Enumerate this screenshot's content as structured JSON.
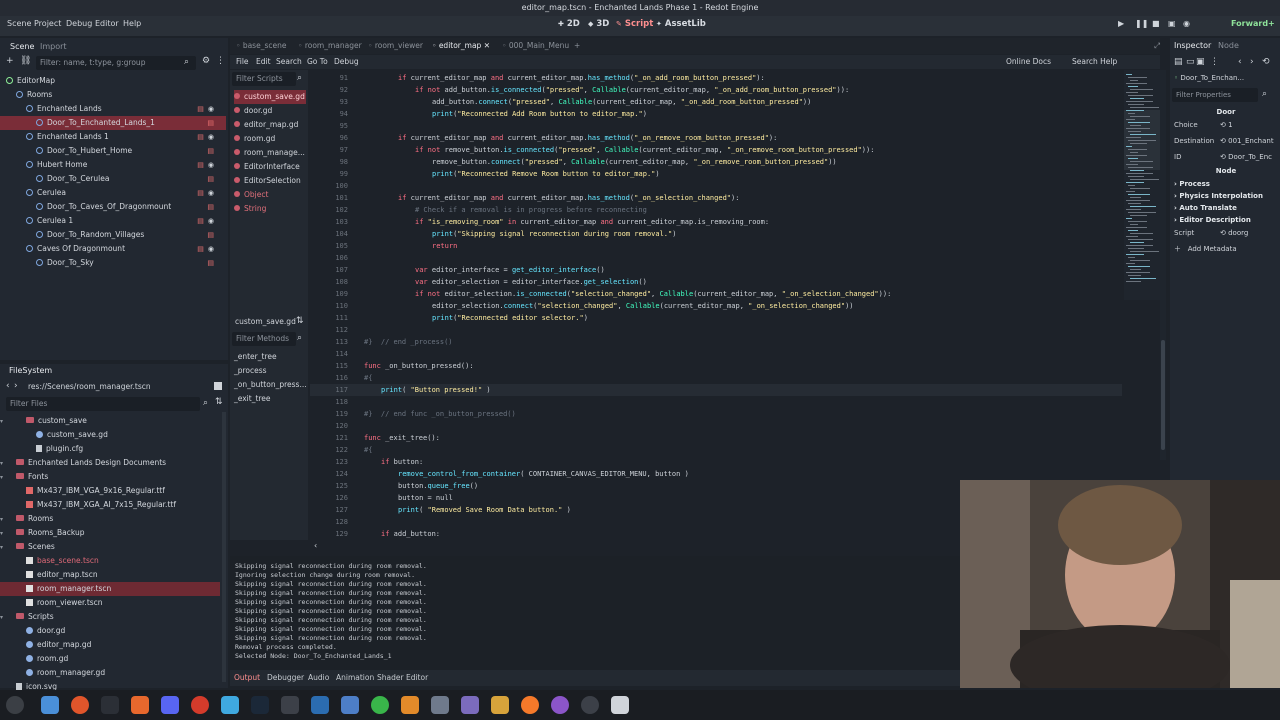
{
  "window": {
    "title": "editor_map.tscn - Enchanted Lands Phase 1 - Redot Engine"
  },
  "menubar": {
    "items": [
      "Scene",
      "Project",
      "Debug",
      "Editor",
      "Help"
    ],
    "workspaces": [
      "2D",
      "3D",
      "Script",
      "AssetLib"
    ],
    "renderer": "Forward+"
  },
  "scene_dock": {
    "tabs": [
      "Scene",
      "Import"
    ],
    "filter_placeholder": "Filter: name, t:type, g:group",
    "nodes": [
      {
        "label": "EditorMap",
        "depth": 0
      },
      {
        "label": "Rooms",
        "depth": 1
      },
      {
        "label": "Enchanted Lands",
        "depth": 2
      },
      {
        "label": "Door_To_Enchanted_Lands_1",
        "depth": 3,
        "selected": true
      },
      {
        "label": "Enchanted Lands 1",
        "depth": 2
      },
      {
        "label": "Door_To_Hubert_Home",
        "depth": 3
      },
      {
        "label": "Hubert Home",
        "depth": 2
      },
      {
        "label": "Door_To_Cerulea",
        "depth": 3
      },
      {
        "label": "Cerulea",
        "depth": 2
      },
      {
        "label": "Door_To_Caves_Of_Dragonmount",
        "depth": 3
      },
      {
        "label": "Cerulea 1",
        "depth": 2
      },
      {
        "label": "Door_To_Random_Villages",
        "depth": 3
      },
      {
        "label": "Caves Of Dragonmount",
        "depth": 2
      },
      {
        "label": "Door_To_Sky",
        "depth": 3
      }
    ]
  },
  "filesystem": {
    "title": "FileSystem",
    "path": "res://Scenes/room_manager.tscn",
    "filter_placeholder": "Filter Files",
    "items": [
      {
        "label": "custom_save",
        "depth": 2,
        "type": "folder"
      },
      {
        "label": "custom_save.gd",
        "depth": 3,
        "type": "gd"
      },
      {
        "label": "plugin.cfg",
        "depth": 3,
        "type": "file"
      },
      {
        "label": "Enchanted Lands Design Documents",
        "depth": 1,
        "type": "folder"
      },
      {
        "label": "Fonts",
        "depth": 1,
        "type": "folder"
      },
      {
        "label": "Mx437_IBM_VGA_9x16_Regular.ttf",
        "depth": 2,
        "type": "font"
      },
      {
        "label": "Mx437_IBM_XGA_AI_7x15_Regular.ttf",
        "depth": 2,
        "type": "font"
      },
      {
        "label": "Rooms",
        "depth": 1,
        "type": "folder"
      },
      {
        "label": "Rooms_Backup",
        "depth": 1,
        "type": "folder"
      },
      {
        "label": "Scenes",
        "depth": 1,
        "type": "folder"
      },
      {
        "label": "base_scene.tscn",
        "depth": 2,
        "type": "tscn",
        "red": true
      },
      {
        "label": "editor_map.tscn",
        "depth": 2,
        "type": "tscn"
      },
      {
        "label": "room_manager.tscn",
        "depth": 2,
        "type": "tscn",
        "selected": true
      },
      {
        "label": "room_viewer.tscn",
        "depth": 2,
        "type": "tscn"
      },
      {
        "label": "Scripts",
        "depth": 1,
        "type": "folder"
      },
      {
        "label": "door.gd",
        "depth": 2,
        "type": "gd"
      },
      {
        "label": "editor_map.gd",
        "depth": 2,
        "type": "gd"
      },
      {
        "label": "room.gd",
        "depth": 2,
        "type": "gd"
      },
      {
        "label": "room_manager.gd",
        "depth": 2,
        "type": "gd"
      },
      {
        "label": "icon.svg",
        "depth": 1,
        "type": "file"
      }
    ]
  },
  "editor_tabs": [
    "base_scene",
    "room_manager",
    "room_viewer",
    "editor_map",
    "000_Main_Menu"
  ],
  "script_menu": [
    "File",
    "Edit",
    "Search",
    "Go To",
    "Debug"
  ],
  "script_menu_right": [
    "Online Docs",
    "Search Help"
  ],
  "script_list": {
    "filter_placeholder": "Filter Scripts",
    "items": [
      "custom_save.gd",
      "door.gd",
      "editor_map.gd",
      "room.gd",
      "room_manage...",
      "EditorInterface",
      "EditorSelection",
      "Object",
      "String"
    ],
    "current": "custom_save.gd",
    "methods_placeholder": "Filter Methods",
    "methods": [
      "_enter_tree",
      "_process",
      "_on_button_press...",
      "_exit_tree"
    ]
  },
  "code_lines": [
    {
      "n": "91",
      "i": 2,
      "t": "if current_editor_map and current_editor_map.has_method(\"_on_add_room_button_pressed\"):"
    },
    {
      "n": "92",
      "i": 3,
      "t": "if not add_button.is_connected(\"pressed\", Callable(current_editor_map, \"_on_add_room_button_pressed\")):"
    },
    {
      "n": "93",
      "i": 4,
      "t": "add_button.connect(\"pressed\", Callable(current_editor_map, \"_on_add_room_button_pressed\"))"
    },
    {
      "n": "94",
      "i": 4,
      "t": "print(\"Reconnected Add Room button to editor_map.\")"
    },
    {
      "n": "95",
      "i": 0,
      "t": ""
    },
    {
      "n": "96",
      "i": 2,
      "t": "if current_editor_map and current_editor_map.has_method(\"_on_remove_room_button_pressed\"):"
    },
    {
      "n": "97",
      "i": 3,
      "t": "if not remove_button.is_connected(\"pressed\", Callable(current_editor_map, \"_on_remove_room_button_pressed\")):"
    },
    {
      "n": "98",
      "i": 4,
      "t": "remove_button.connect(\"pressed\", Callable(current_editor_map, \"_on_remove_room_button_pressed\"))"
    },
    {
      "n": "99",
      "i": 4,
      "t": "print(\"Reconnected Remove Room button to editor_map.\")"
    },
    {
      "n": "100",
      "i": 0,
      "t": ""
    },
    {
      "n": "101",
      "i": 2,
      "t": "if current_editor_map and current_editor_map.has_method(\"_on_selection_changed\"):"
    },
    {
      "n": "102",
      "i": 3,
      "t": "# Check if a removal is in progress before reconnecting"
    },
    {
      "n": "103",
      "i": 3,
      "t": "if \"is_removing_room\" in current_editor_map and current_editor_map.is_removing_room:"
    },
    {
      "n": "104",
      "i": 4,
      "t": "print(\"Skipping signal reconnection during room removal.\")"
    },
    {
      "n": "105",
      "i": 4,
      "t": "return"
    },
    {
      "n": "106",
      "i": 0,
      "t": ""
    },
    {
      "n": "107",
      "i": 3,
      "t": "var editor_interface = get_editor_interface()"
    },
    {
      "n": "108",
      "i": 3,
      "t": "var editor_selection = editor_interface.get_selection()"
    },
    {
      "n": "109",
      "i": 3,
      "t": "if not editor_selection.is_connected(\"selection_changed\", Callable(current_editor_map, \"_on_selection_changed\")):"
    },
    {
      "n": "110",
      "i": 4,
      "t": "editor_selection.connect(\"selection_changed\", Callable(current_editor_map, \"_on_selection_changed\"))"
    },
    {
      "n": "111",
      "i": 4,
      "t": "print(\"Reconnected editor selector.\")"
    },
    {
      "n": "112",
      "i": 0,
      "t": ""
    },
    {
      "n": "113",
      "i": 0,
      "t": "#}  // end _process()"
    },
    {
      "n": "114",
      "i": 0,
      "t": ""
    },
    {
      "n": "115",
      "i": 0,
      "t": "func _on_button_pressed():"
    },
    {
      "n": "116",
      "i": 0,
      "t": "#{"
    },
    {
      "n": "117",
      "i": 1,
      "t": "print( \"Button pressed!\" )"
    },
    {
      "n": "118",
      "i": 0,
      "t": ""
    },
    {
      "n": "119",
      "i": 0,
      "t": "#}  // end func _on_button_pressed()"
    },
    {
      "n": "120",
      "i": 0,
      "t": ""
    },
    {
      "n": "121",
      "i": 0,
      "t": "func _exit_tree():"
    },
    {
      "n": "122",
      "i": 0,
      "t": "#{"
    },
    {
      "n": "123",
      "i": 1,
      "t": "if button:"
    },
    {
      "n": "124",
      "i": 2,
      "t": "remove_control_from_container( CONTAINER_CANVAS_EDITOR_MENU, button )"
    },
    {
      "n": "125",
      "i": 2,
      "t": "button.queue_free()"
    },
    {
      "n": "126",
      "i": 2,
      "t": "button = null"
    },
    {
      "n": "127",
      "i": 2,
      "t": "print( \"Removed Save Room Data button.\" )"
    },
    {
      "n": "128",
      "i": 0,
      "t": ""
    },
    {
      "n": "129",
      "i": 1,
      "t": "if add_button:"
    }
  ],
  "output": {
    "lines": [
      "Skipping signal reconnection during room removal.",
      "Ignoring selection change during room removal.",
      "Skipping signal reconnection during room removal.",
      "Skipping signal reconnection during room removal.",
      "Skipping signal reconnection during room removal.",
      "Skipping signal reconnection during room removal.",
      "Skipping signal reconnection during room removal.",
      "Skipping signal reconnection during room removal.",
      "Skipping signal reconnection during room removal.",
      "Removal process completed.",
      "Selected Node: Door_To_Enchanted_Lands_1"
    ],
    "tabs": [
      "Output",
      "Debugger",
      "Audio",
      "Animation",
      "Shader Editor"
    ]
  },
  "inspector": {
    "tabs": [
      "Inspector",
      "Node"
    ],
    "object_name": "Door_To_Enchan...",
    "filter_placeholder": "Filter Properties",
    "class_name": "Door",
    "properties": [
      {
        "label": "Choice",
        "value": "1"
      },
      {
        "label": "Destination",
        "value": "001_Enchant"
      },
      {
        "label": "ID",
        "value": "Door_To_Enc"
      }
    ],
    "node_section": "Node",
    "sections": [
      "Process",
      "Physics Interpolation",
      "Auto Translate",
      "Editor Description"
    ],
    "script_label": "Script",
    "script_value": "doorg",
    "add_metadata": "Add Metadata"
  },
  "colors": {
    "accent": "#fe8f8f",
    "selection": "#7a2d38"
  }
}
